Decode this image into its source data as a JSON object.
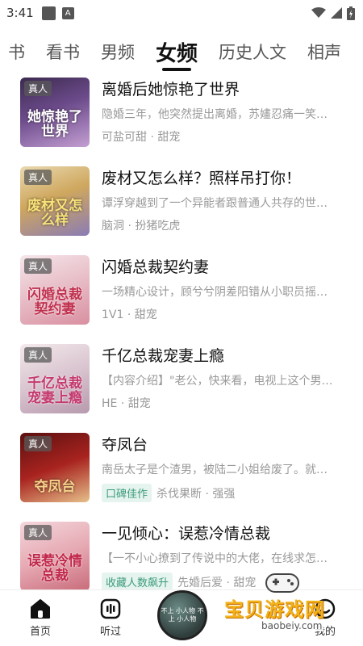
{
  "status_bar": {
    "time": "3:41",
    "notification_icon": "A"
  },
  "tabs": [
    {
      "label": "书"
    },
    {
      "label": "看书"
    },
    {
      "label": "男频"
    },
    {
      "label": "女频",
      "active": true
    },
    {
      "label": "历史人文"
    },
    {
      "label": "相声"
    }
  ],
  "books": [
    {
      "tag": "真人",
      "cover_text": "她惊艳了世界",
      "title": "离婚后她惊艳了世界",
      "description": "隐婚三年，他突然提出离婚，苏嫿忍痛一笑…",
      "labels": [
        "可盐可甜 · 甜宠"
      ],
      "badge": ""
    },
    {
      "tag": "真人",
      "cover_text": "废材又怎么样",
      "title": "废材又怎么样？照样吊打你！",
      "description": "谭浮穿越到了一个异能者跟普通人共存的世…",
      "labels": [
        "脑洞 · 扮猪吃虎"
      ],
      "badge": ""
    },
    {
      "tag": "真人",
      "cover_text": "闪婚总裁契约妻",
      "title": "闪婚总裁契约妻",
      "description": "一场精心设计，顾兮兮阴差阳错从小职员摇…",
      "labels": [
        "1V1 · 甜宠"
      ],
      "badge": ""
    },
    {
      "tag": "真人",
      "cover_text": "千亿总裁宠妻上瘾",
      "title": "千亿总裁宠妻上瘾",
      "description": "【内容介绍】\"老公，快来看，电视上这个男…",
      "labels": [
        "HE · 甜宠"
      ],
      "badge": ""
    },
    {
      "tag": "真人",
      "cover_text": "夺凤台",
      "title": "夺凤台",
      "description": "南岳太子是个渣男，被陆二小姐给废了。就…",
      "labels": [
        "杀伐果断 · 强强"
      ],
      "badge": "口碑佳作"
    },
    {
      "tag": "真人",
      "cover_text": "误惹冷情总裁",
      "title": "一见倾心：误惹冷情总裁",
      "description": "【一不小心撩到了传说中的大佬，在线求怎…",
      "labels": [
        "先婚后爱 · 甜宠"
      ],
      "badge": "收藏人数飙升"
    }
  ],
  "bottom_nav": {
    "home": "首页",
    "listened": "听过",
    "mine": "我的",
    "disc_text": "不上 小人物\n不上 小人物"
  },
  "watermark": {
    "title": "宝贝游戏网",
    "url": "baobeiy.com"
  },
  "colors": {
    "accent": "#3a9a7a",
    "badge_bg": "#e6f4ef",
    "watermark": "#f2b21a"
  }
}
